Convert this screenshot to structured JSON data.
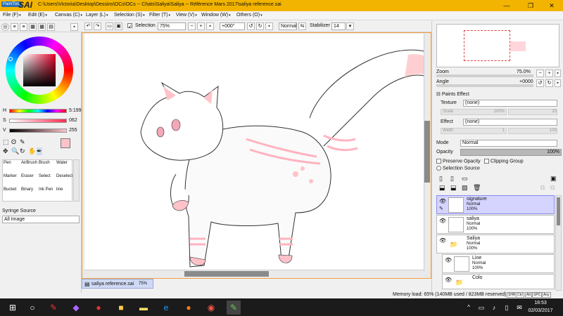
{
  "app": {
    "logo_small": "PaintTool",
    "logo_big": "SAI",
    "title": "C:\\Users\\Victoria\\Desktop\\Dessins\\OCs\\OCs -- Chats\\Saliya\\Saliya -- Référence Mars 2017\\saliya reference.sai"
  },
  "window_buttons": [
    "—",
    "❐",
    "✕"
  ],
  "menu": [
    {
      "label": "File (F)"
    },
    {
      "label": "Edit (E)"
    },
    {
      "label": "Canvas (C)"
    },
    {
      "label": "Layer (L)"
    },
    {
      "label": "Selection (S)"
    },
    {
      "label": "Filter (T)"
    },
    {
      "label": "View (V)"
    },
    {
      "label": "Window (W)"
    },
    {
      "label": "Others (O)"
    }
  ],
  "toolbar": {
    "selection_label": "Selection",
    "zoom_value": "75%",
    "angle_value": "+000°",
    "mode_value": "Normal",
    "stabilizer_label": "Stabilizer",
    "stabilizer_value": "14"
  },
  "color": {
    "h_label": "H",
    "h_value": "5:199",
    "s_label": "S",
    "s_value": "062",
    "v_label": "V",
    "v_value": "255",
    "current_color": "#ffc2c8"
  },
  "tools": {
    "brushes": [
      "Pen",
      "AirBrush",
      "Brush",
      "Water",
      "Marker",
      "Eraser",
      "Select",
      "Deselect",
      "Bucket",
      "Binary",
      "Ink Pen",
      "line"
    ]
  },
  "syringe": {
    "label": "Syringe Source",
    "value": "All Image"
  },
  "navigator": {
    "zoom_label": "Zoom",
    "zoom_value": "75.0%",
    "angle_label": "Angle",
    "angle_value": "+0000"
  },
  "paints_effect": {
    "header": "Paints Effect",
    "texture_label": "Texture",
    "texture_value": "(none)",
    "scale_label": "Scale",
    "scale_value": "100%",
    "scale_num": "20",
    "effect_label": "Effect",
    "effect_value": "(none)",
    "width_label": "Width",
    "width_value": "1",
    "width_num": "100"
  },
  "layer_props": {
    "mode_label": "Mode",
    "mode_value": "Normal",
    "opacity_label": "Opacity",
    "opacity_value": "100%",
    "preserve_opacity": "Preserve Opacity",
    "clipping_group": "Clipping Group",
    "selection_source": "Selection Source"
  },
  "layers": [
    {
      "name": "signature",
      "mode": "Normal",
      "opacity": "100%",
      "selected": true
    },
    {
      "name": "saliya",
      "mode": "Normal",
      "opacity": "100%",
      "selected": false
    },
    {
      "name": "Saliya",
      "mode": "Normal",
      "opacity": "100%",
      "selected": false
    },
    {
      "name": "Line",
      "mode": "Normal",
      "opacity": "100%",
      "selected": false
    },
    {
      "name": "Colo",
      "mode": "",
      "opacity": "",
      "selected": false
    }
  ],
  "document_tab": {
    "name": "saliya reference.sai",
    "zoom": "75%"
  },
  "status": {
    "memory": "Memory load: 65% (140MB used / 823MB reserved)",
    "keys": [
      "SHR",
      "Ctrl",
      "Alt",
      "SPC",
      "Any"
    ]
  },
  "taskbar": {
    "time": "18:53",
    "date": "02/03/2017"
  }
}
